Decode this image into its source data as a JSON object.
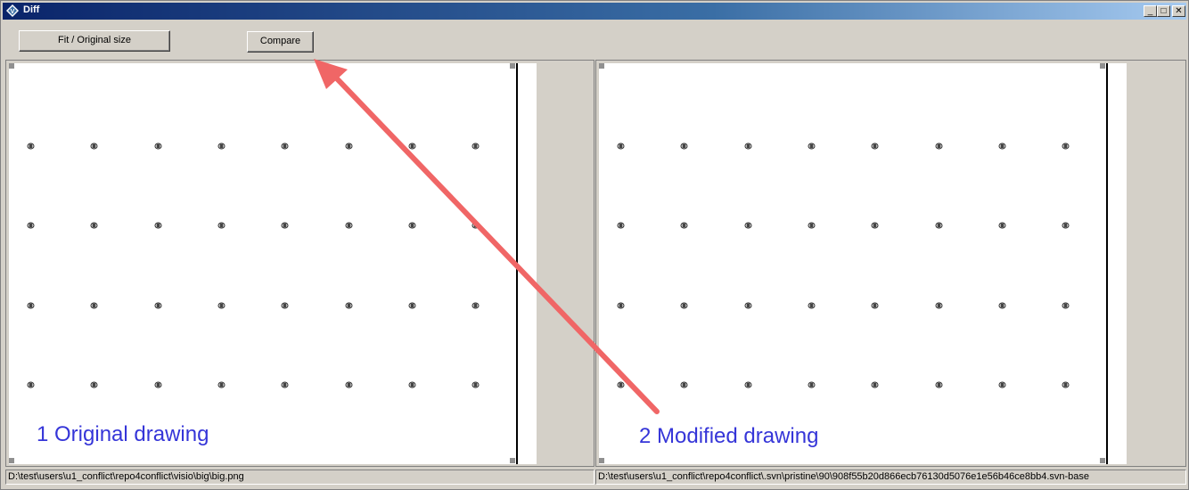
{
  "window": {
    "title": "Diff",
    "icon": "diff-app-icon",
    "controls": [
      "minimize-icon",
      "maximize-icon",
      "close-icon"
    ]
  },
  "toolbar": {
    "fit_label": "Fit / Original size",
    "compare_label": "Compare"
  },
  "left_panel": {
    "caption": "1 Original drawing",
    "path": "D:\\test\\users\\u1_conflict\\repo4conflict\\visio\\big\\big.png"
  },
  "right_panel": {
    "caption": "2 Modified drawing",
    "path": "D:\\test\\users\\u1_conflict\\repo4conflict\\.svn\\pristine\\90\\908f55b20d866ecb76130d5076e1e56b46ce8bb4.svn-base"
  },
  "annotation": {
    "arrow_color": "#f06666",
    "caption_color": "#3535d8"
  },
  "colors": {
    "titlebar_start": "#0a246a",
    "titlebar_end": "#a6caf0",
    "face": "#d4d0c8"
  }
}
